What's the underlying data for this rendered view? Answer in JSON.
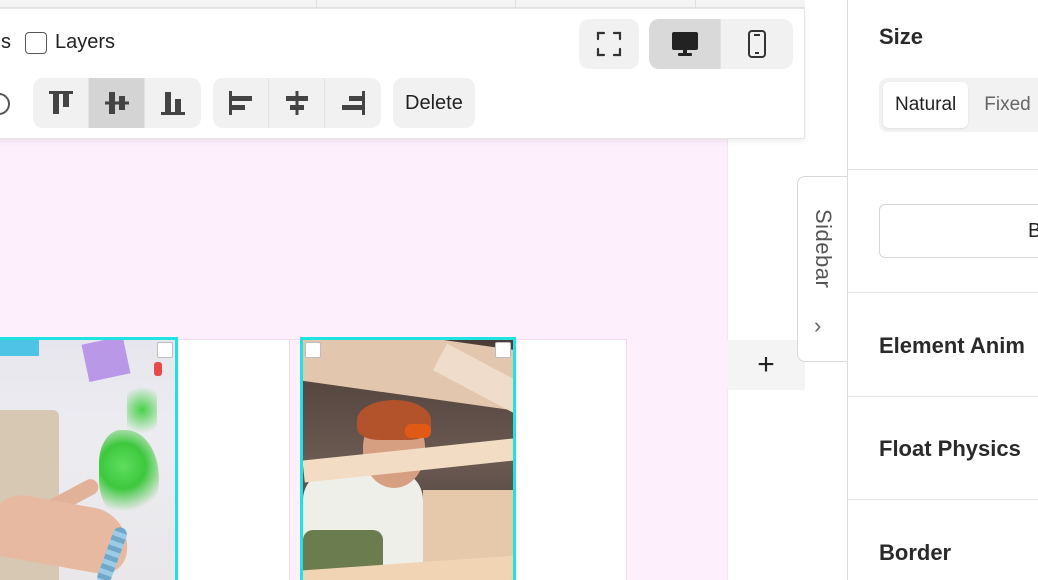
{
  "toolbar": {
    "clipped_label": "s",
    "layers_label": "Layers",
    "delete_label": "Delete"
  },
  "sidebar_tab": {
    "label": "Sidebar",
    "chevron": "›"
  },
  "canvas": {
    "add_row_glyph": "+"
  },
  "panel": {
    "size_title": "Size",
    "size_options": [
      "Natural",
      "Fixed"
    ],
    "size_selected": "Natural",
    "button_label": "B",
    "element_animation_title": "Element Anim",
    "float_physics_title": "Float Physics",
    "border_title": "Border"
  },
  "icons": {
    "fullscreen": "fullscreen-icon",
    "desktop": "desktop-icon",
    "mobile": "mobile-icon",
    "align_top": "align-top-icon",
    "align_middle": "align-vertical-center-icon",
    "align_bottom": "align-bottom-icon",
    "align_left": "align-left-icon",
    "align_center": "align-horizontal-center-icon",
    "align_right": "align-right-icon",
    "refresh": "refresh-icon"
  },
  "colors": {
    "canvas_bg": "#fdf0fc",
    "selection": "#1fe3e3",
    "button_bg": "#f1f1f1",
    "active_bg": "#d4d4d4"
  }
}
